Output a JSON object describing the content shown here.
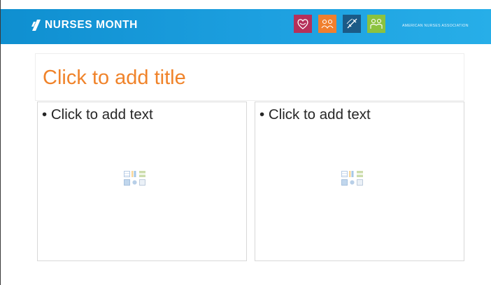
{
  "header": {
    "brand_text": "NURSES MONTH",
    "organization_text": "AMERICAN NURSES ASSOCIATION",
    "banner_color": "#1a9cdc",
    "badges": [
      {
        "icon": "heart-hands-icon",
        "color": "#b5305a"
      },
      {
        "icon": "group-icon",
        "color": "#f07f2e"
      },
      {
        "icon": "syringe-icon",
        "color": "#1b5a86"
      },
      {
        "icon": "people-icon",
        "color": "#8cc23f"
      }
    ]
  },
  "slide": {
    "title_placeholder": "Click to add title",
    "title_color": "#f0832a",
    "left_content": {
      "bullet": "• Click to add text"
    },
    "right_content": {
      "bullet": "• Click to add text"
    }
  }
}
